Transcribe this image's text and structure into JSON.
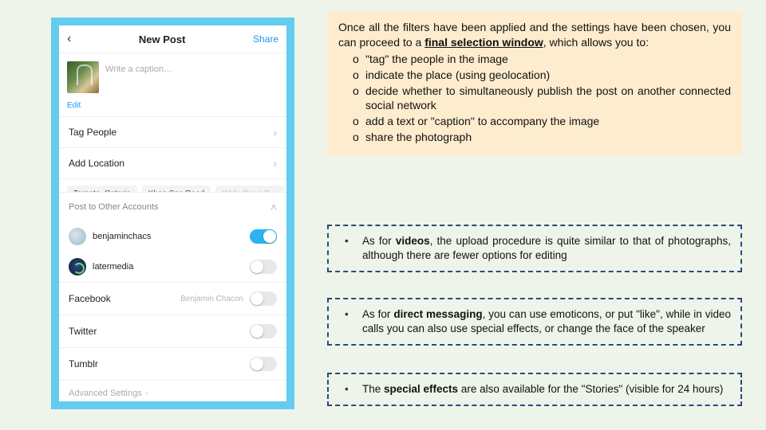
{
  "phone": {
    "back": "‹",
    "title": "New Post",
    "share": "Share",
    "caption_placeholder": "Write a caption…",
    "edit": "Edit",
    "tag_people": "Tag People",
    "add_location": "Add Location",
    "chips": [
      "Toronto, Ontario",
      "Khao San Road",
      "Wide Open B…"
    ],
    "post_other": "Post to Other Accounts",
    "accounts": [
      {
        "name": "benjaminchacs",
        "on": true
      },
      {
        "name": "latermedia",
        "on": false
      }
    ],
    "networks": [
      {
        "name": "Facebook",
        "sub": "Benjamin Chacon",
        "on": false
      },
      {
        "name": "Twitter",
        "sub": "",
        "on": false
      },
      {
        "name": "Tumblr",
        "sub": "",
        "on": false
      }
    ],
    "advanced": "Advanced Settings"
  },
  "main": {
    "intro_a": "Once all the filters have been applied and the settings have been chosen, you can proceed to a ",
    "intro_b": "final selection window",
    "intro_c": ", which allows you to:",
    "items": [
      "\"tag\" the people in the image",
      "indicate the place (using geolocation)",
      "decide whether to simultaneously publish the post on another connected social network",
      "add a text or \"caption\" to accompany the image",
      "share the photograph"
    ]
  },
  "box1": {
    "a": "As for ",
    "b": "videos",
    "c": ", the upload procedure is quite similar to that of photographs, although there are fewer options for editing"
  },
  "box2": {
    "a": "As for ",
    "b": "direct messaging",
    "c": ", you can use emoticons, or put \"like\", while in video calls you can also use special effects, or change the face of the speaker"
  },
  "box3": {
    "a": "The ",
    "b": "special effects",
    "c": " are also available for the \"Stories\" (visible for 24 hours)"
  }
}
